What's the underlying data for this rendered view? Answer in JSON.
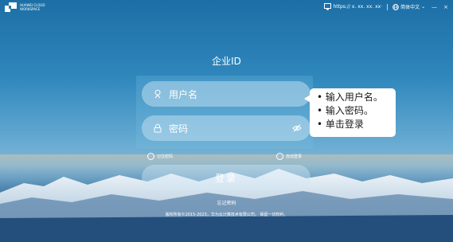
{
  "topbar": {
    "logo_line1": "HUAWEI CLOUD",
    "logo_line2": "WORKSPACE",
    "url": "https:// x. xx. xx. xx·",
    "language": "简体中文",
    "minimize": "—",
    "close": "×"
  },
  "login": {
    "title": "企业ID",
    "username_placeholder": "用户名",
    "password_placeholder": "密码",
    "remember_password": "记住密码",
    "auto_login": "自动登录",
    "login_button": "登录",
    "forgot_password": "忘记密码",
    "copyright": "版权所有©2015-2023，华为云计算技术有限公司。 保留一切权利。"
  },
  "tooltip": {
    "lines": [
      "• 输入用户名。",
      "• 输入密码。",
      "• 单击登录"
    ]
  },
  "colors": {
    "sky_top": "#1c6fa6",
    "sky_mid": "#5ea6cf",
    "tooltip_bg": "#ffffff"
  }
}
